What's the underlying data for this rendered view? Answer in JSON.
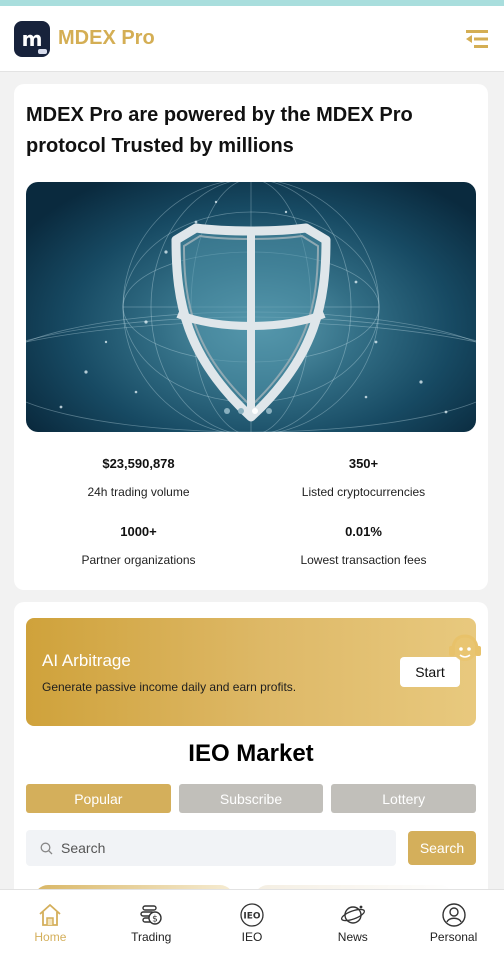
{
  "header": {
    "brand": "MDEX Pro",
    "logo_letter": "m",
    "menu_icon": "menu-icon"
  },
  "hero": {
    "headline": "MDEX Pro are powered by the MDEX Pro protocol Trusted by millions",
    "banner_icon": "shield-globe-icon",
    "carousel_active_index": 2,
    "carousel_count": 4
  },
  "stats": [
    {
      "value": "$23,590,878",
      "label": "24h trading volume"
    },
    {
      "value": "350+",
      "label": "Listed cryptocurrencies"
    },
    {
      "value": "1000+",
      "label": "Partner organizations"
    },
    {
      "value": "0.01%",
      "label": "Lowest transaction fees"
    }
  ],
  "ai": {
    "title": "AI Arbitrage",
    "subtitle": "Generate passive income daily and earn profits.",
    "button": "Start"
  },
  "ieo": {
    "title": "IEO Market",
    "tabs": [
      {
        "label": "Popular",
        "active": true
      },
      {
        "label": "Subscribe",
        "active": false
      },
      {
        "label": "Lottery",
        "active": false
      }
    ],
    "search_placeholder": "Search",
    "search_button": "Search"
  },
  "nav": [
    {
      "label": "Home",
      "icon": "home-icon",
      "active": true
    },
    {
      "label": "Trading",
      "icon": "trading-icon",
      "active": false
    },
    {
      "label": "IEO",
      "icon": "ieo-icon",
      "active": false
    },
    {
      "label": "News",
      "icon": "news-icon",
      "active": false
    },
    {
      "label": "Personal",
      "icon": "personal-icon",
      "active": false
    }
  ],
  "colors": {
    "accent": "#d4af5b",
    "brand_text": "#d4ae54",
    "tab_inactive": "#c1bfba",
    "logo_bg": "#17223b"
  }
}
